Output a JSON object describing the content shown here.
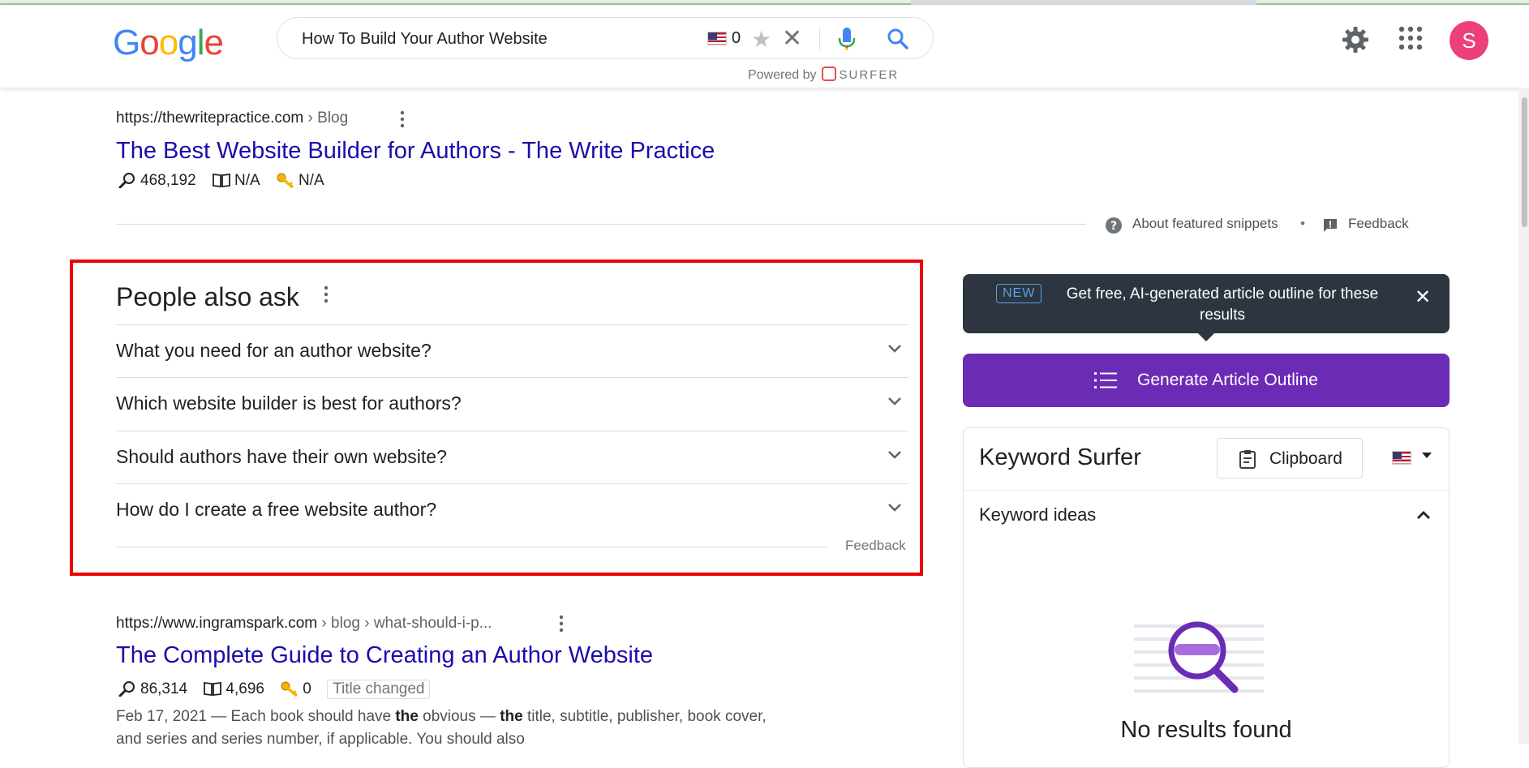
{
  "search": {
    "query": "How To Build Your Author Website",
    "count": "0",
    "powered_by": "Powered by",
    "brand": "SURFER"
  },
  "logo": {
    "letters": [
      "G",
      "o",
      "o",
      "g",
      "l",
      "e"
    ],
    "colors": [
      "#4285f4",
      "#ea4335",
      "#fbbc05",
      "#4285f4",
      "#34a853",
      "#ea4335"
    ]
  },
  "avatar": {
    "letter": "S",
    "color": "#ec407a"
  },
  "result1": {
    "url": "https://thewritepractice.com",
    "crumb": "› Blog",
    "title": "The Best Website Builder for Authors - The Write Practice",
    "volume": "468,192",
    "pages": "N/A",
    "keys": "N/A"
  },
  "snippet_bar": {
    "about": "About featured snippets",
    "bullet": "•",
    "feedback": "Feedback"
  },
  "paa": {
    "title": "People also ask",
    "questions": [
      "What you need for an author website?",
      "Which website builder is best for authors?",
      "Should authors have their own website?",
      "How do I create a free website author?"
    ],
    "feedback": "Feedback"
  },
  "result2": {
    "url": "https://www.ingramspark.com",
    "crumb": "› blog › what-should-i-p...",
    "title": "The Complete Guide to Creating an Author Website",
    "volume": "86,314",
    "pages": "4,696",
    "keys": "0",
    "badge": "Title changed",
    "date": "Feb 17, 2021",
    "snippet_parts": [
      " — Each book should have ",
      "the",
      " obvious — ",
      "the",
      " title, subtitle, publisher, book cover,"
    ],
    "snippet_line2": "and series and series number, if applicable. You should also"
  },
  "surfer": {
    "tooltip_new": "NEW",
    "tooltip_text": "Get free, AI-generated article outline for these results",
    "generate_label": "Generate Article Outline",
    "panel_title": "Keyword Surfer",
    "clipboard_label": "Clipboard",
    "keyword_ideas": "Keyword ideas",
    "no_results": "No results found",
    "accent": "#6c2bb5"
  }
}
